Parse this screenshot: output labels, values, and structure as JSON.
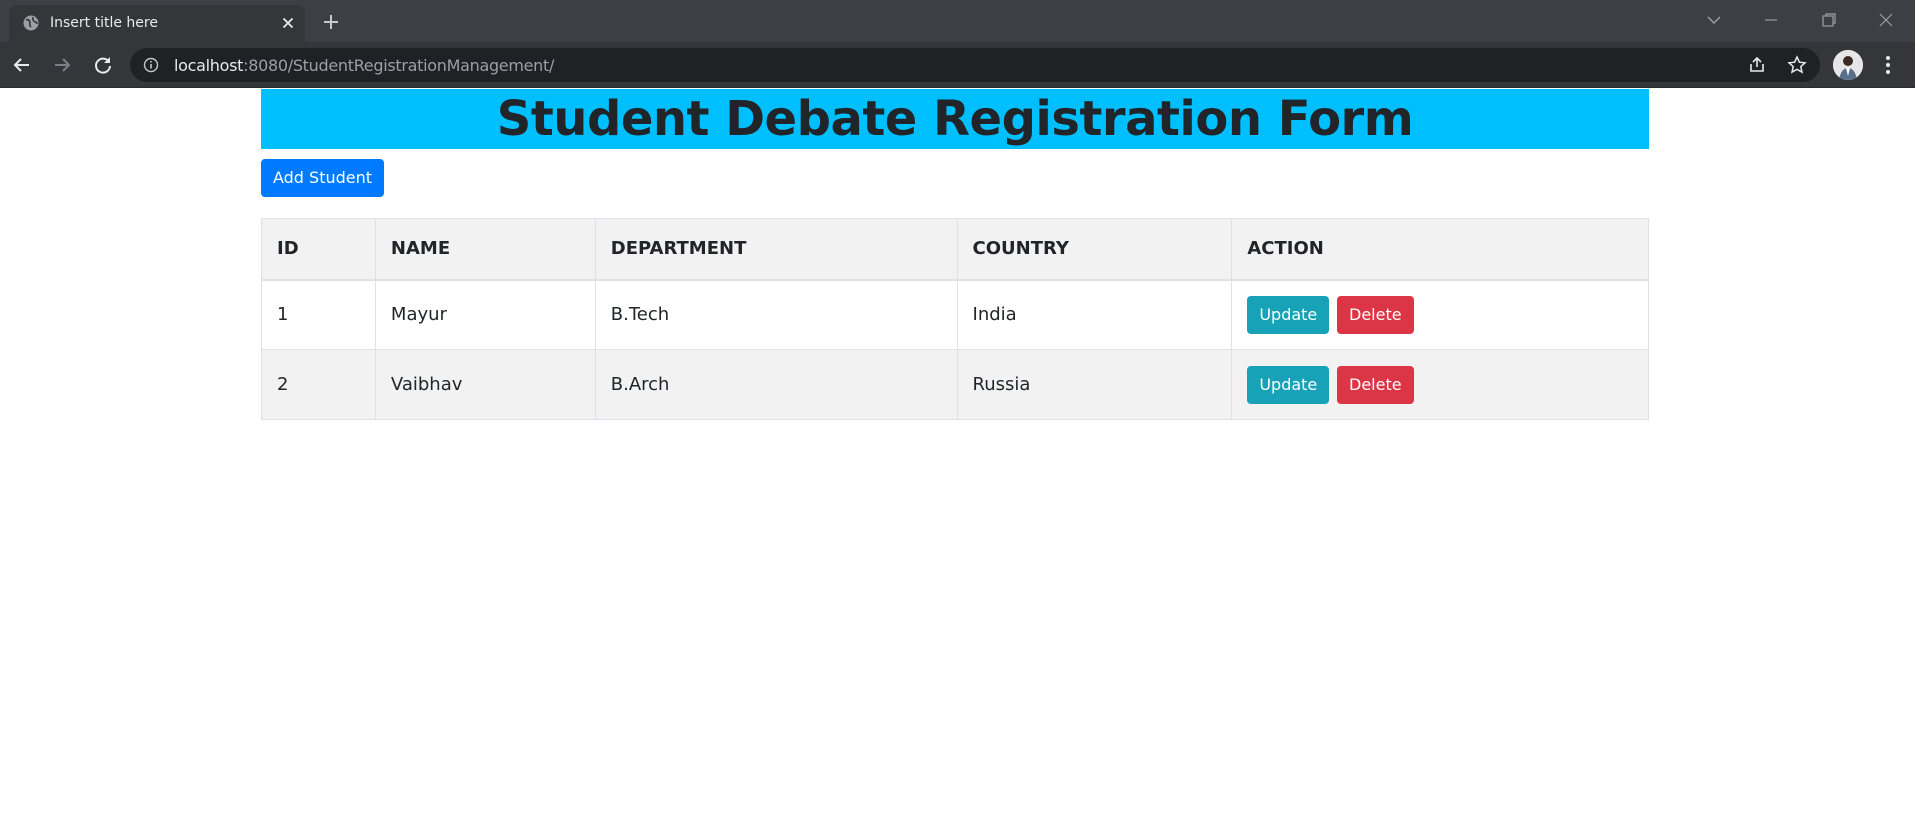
{
  "browser": {
    "tab_title": "Insert title here",
    "url_host": "localhost",
    "url_rest": ":8080/StudentRegistrationManagement/"
  },
  "page": {
    "title": "Student Debate Registration Form",
    "add_button_label": "Add Student",
    "header_color": "#00bfff"
  },
  "table": {
    "headers": [
      "ID",
      "NAME",
      "DEPARTMENT",
      "COUNTRY",
      "ACTION"
    ],
    "rows": [
      {
        "id": "1",
        "name": "Mayur",
        "department": "B.Tech",
        "country": "India",
        "update_label": "Update",
        "delete_label": "Delete"
      },
      {
        "id": "2",
        "name": "Vaibhav",
        "department": "B.Arch",
        "country": "Russia",
        "update_label": "Update",
        "delete_label": "Delete"
      }
    ]
  },
  "icons": {
    "tab_favicon": "globe-icon",
    "tab_close": "close-icon",
    "new_tab": "plus-icon",
    "back": "arrow-left-icon",
    "forward": "arrow-right-icon",
    "reload": "reload-icon",
    "site_info": "info-icon",
    "share": "share-icon",
    "bookmark": "star-icon",
    "profile": "avatar",
    "menu": "kebab-menu-icon"
  }
}
